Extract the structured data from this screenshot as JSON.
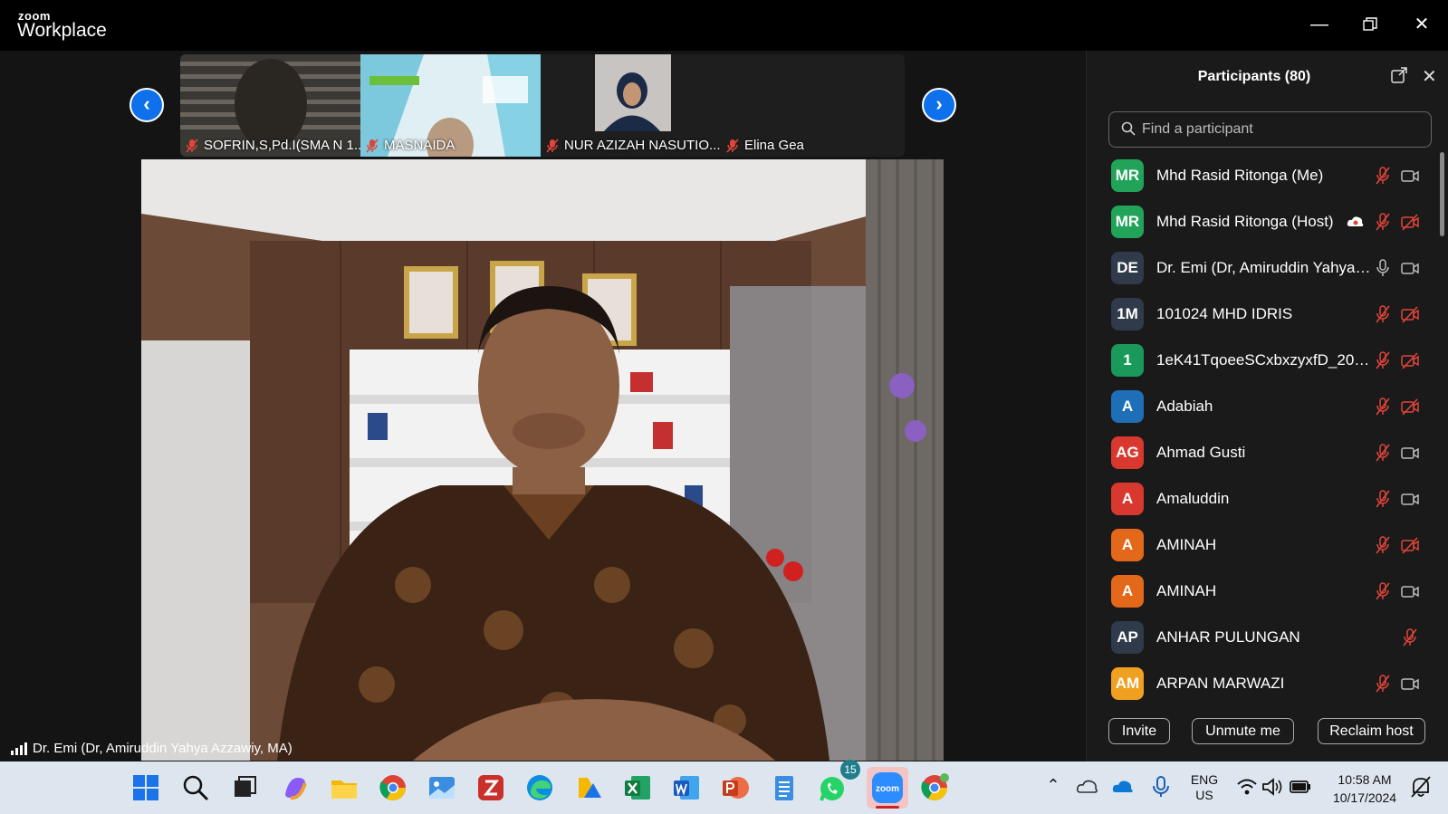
{
  "app": {
    "brand_top": "zoom",
    "brand_bottom": "Workplace"
  },
  "thumbnails": [
    {
      "name": "SOFRIN,S,Pd.I(SMA N 1..."
    },
    {
      "name": "MASNAIDA"
    },
    {
      "name": "NUR AZIZAH NASUTIO..."
    },
    {
      "name": "Elina Gea"
    }
  ],
  "speaker": {
    "name": "Dr. Emi (Dr, Amiruddin Yahya Azzawiy, MA)"
  },
  "panel": {
    "title": "Participants (80)",
    "search_placeholder": "Find a participant",
    "participants": [
      {
        "initials": "MR",
        "name": "Mhd Rasid Ritonga (Me)",
        "color": "#22a35a",
        "mic": "muted",
        "video": "on"
      },
      {
        "initials": "MR",
        "name": "Mhd Rasid Ritonga (Host)",
        "color": "#22a35a",
        "mic": "muted",
        "video": "off",
        "cloud": true
      },
      {
        "initials": "DE",
        "name": "Dr. Emi (Dr, Amiruddin Yahya A...",
        "color": "#2f3a4a",
        "mic": "on",
        "video": "on"
      },
      {
        "initials": "1M",
        "name": "101024 MHD IDRIS",
        "color": "#2f3a4a",
        "mic": "muted",
        "video": "off"
      },
      {
        "initials": "1",
        "name": "1eK41TqoeeSCxbxzyxfD_201Sw...",
        "color": "#1a9a5a",
        "mic": "muted",
        "video": "off"
      },
      {
        "initials": "A",
        "name": "Adabiah",
        "color": "#1e6fb8",
        "mic": "muted",
        "video": "off"
      },
      {
        "initials": "AG",
        "name": "Ahmad Gusti",
        "color": "#d9382f",
        "mic": "muted",
        "video": "on"
      },
      {
        "initials": "A",
        "name": "Amaluddin",
        "color": "#d9382f",
        "mic": "muted",
        "video": "on"
      },
      {
        "initials": "A",
        "name": "AMINAH",
        "color": "#e3681a",
        "mic": "muted",
        "video": "off"
      },
      {
        "initials": "A",
        "name": "AMINAH",
        "color": "#e3681a",
        "mic": "muted",
        "video": "on"
      },
      {
        "initials": "AP",
        "name": "ANHAR PULUNGAN",
        "color": "#2f3a4a",
        "mic": "muted_only",
        "video": "none"
      },
      {
        "initials": "AM",
        "name": "ARPAN MARWAZI",
        "color": "#f0a020",
        "mic": "muted",
        "video": "on"
      }
    ],
    "buttons": {
      "invite": "Invite",
      "unmute": "Unmute me",
      "reclaim": "Reclaim host"
    }
  },
  "taskbar": {
    "whatsapp_badge": "15",
    "lang_top": "ENG",
    "lang_bottom": "US",
    "time": "10:58 AM",
    "date": "10/17/2024"
  }
}
